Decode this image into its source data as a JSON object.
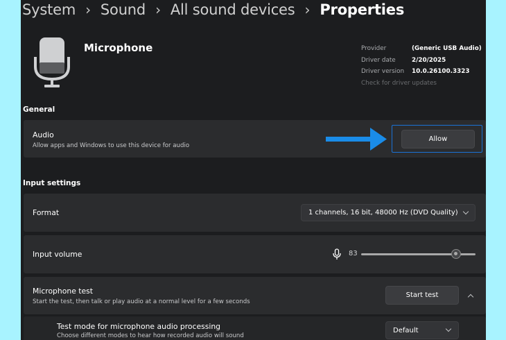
{
  "breadcrumb": [
    "System",
    "Sound",
    "All sound devices",
    "Properties"
  ],
  "device": {
    "name": "Microphone",
    "icon": "microphone-device-icon"
  },
  "driver": {
    "rows": [
      {
        "label": "Provider",
        "value": "(Generic USB Audio)"
      },
      {
        "label": "Driver date",
        "value": "2/20/2025"
      },
      {
        "label": "Driver version",
        "value": "10.0.26100.3323"
      }
    ],
    "update_link": "Check for driver updates"
  },
  "general": {
    "heading": "General",
    "audio": {
      "label": "Audio",
      "description": "Allow apps and Windows to use this device for audio",
      "button": "Allow"
    }
  },
  "input_settings": {
    "heading": "Input settings",
    "format": {
      "label": "Format",
      "value": "1 channels, 16 bit, 48000 Hz (DVD Quality)"
    },
    "volume": {
      "label": "Input volume",
      "value": "83",
      "level": 83
    },
    "mic_test": {
      "label": "Microphone test",
      "description": "Start the test, then talk or play audio at a normal level for a few seconds",
      "button": "Start test"
    },
    "test_mode": {
      "label": "Test mode for microphone audio processing",
      "description": "Choose different modes to hear how recorded audio will sound",
      "value": "Default"
    }
  },
  "colors": {
    "accent": "#1a73d8",
    "arrow": "#1a8ce8"
  }
}
